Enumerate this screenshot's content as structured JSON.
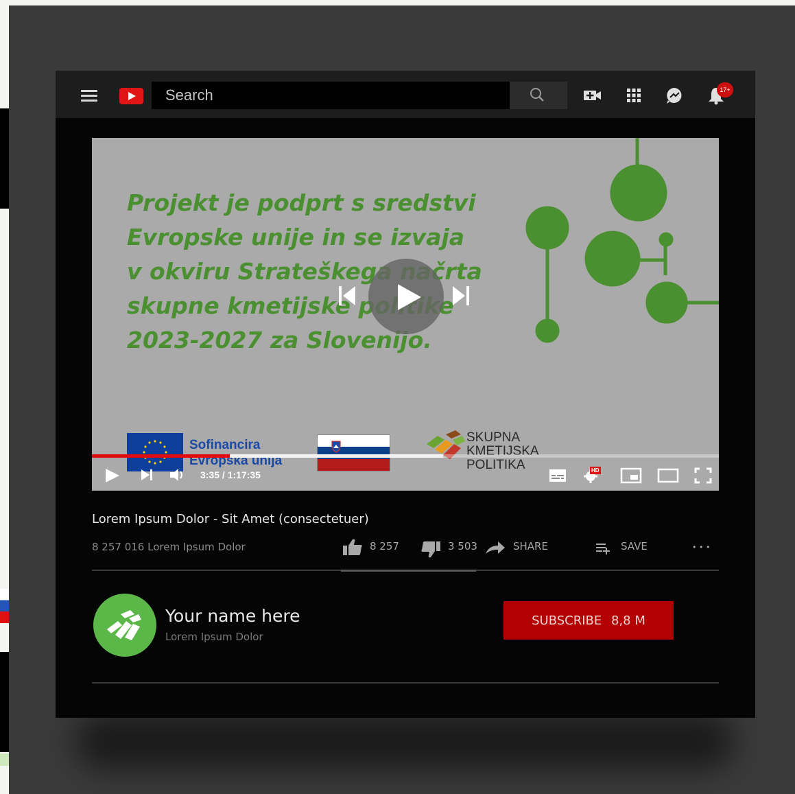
{
  "header": {
    "search_placeholder": "Search",
    "notification_count": "17+"
  },
  "video": {
    "slide_lines": [
      "Projekt je podprt s sredstvi",
      "Evropske unije in se izvaja",
      "v okviru Strateškega načrta",
      "skupne kmetijske politike",
      "2023-2027 za Slovenijo."
    ],
    "eu_text_line1": "Sofinancira",
    "eu_text_line2": "Evropska unija",
    "skp_lines": [
      "SKUPNA",
      "KMETIJSKA",
      "POLITIKA"
    ],
    "time_display": "3:35 / 1:17:35",
    "hd_label": "HD",
    "progress_played_fraction": 0.22,
    "progress_buffered_fraction": 0.56,
    "colors": {
      "slide_green": "#4a8f30",
      "progress_red": "#e00c0c"
    }
  },
  "meta": {
    "title": "Lorem Ipsum Dolor - Sit Amet (consectetuer)",
    "views": "8 257 016 Lorem Ipsum Dolor",
    "likes": "8 257",
    "dislikes": "3 503",
    "share_label": "SHARE",
    "save_label": "SAVE",
    "more_label": "• • •"
  },
  "channel": {
    "name": "Your name here",
    "subtitle": "Lorem Ipsum Dolor",
    "subscribe_label": "SUBSCRIBE",
    "subscriber_count": "8,8 M"
  }
}
